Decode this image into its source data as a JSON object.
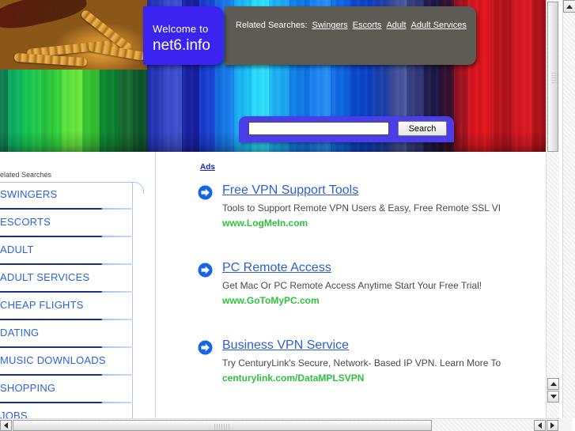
{
  "banner": {
    "welcome": {
      "line1": "Welcome to",
      "line2": "net6.info",
      "bg_color": "#3c24f0"
    },
    "related_bar": {
      "label": "Related Searches:",
      "bg_color": "#5e5b55",
      "links": [
        "Swingers",
        "Escorts",
        "Adult",
        "Adult Services"
      ]
    },
    "search": {
      "value": "",
      "placeholder": "",
      "button_label": "Search",
      "bar_color": "#4b3de8"
    }
  },
  "sidebar": {
    "title": "elated Searches",
    "link_color": "#2a63e0",
    "items": [
      {
        "label": "SWINGERS"
      },
      {
        "label": "ESCORTS"
      },
      {
        "label": "ADULT"
      },
      {
        "label": "ADULT SERVICES"
      },
      {
        "label": "CHEAP FLIGHTS"
      },
      {
        "label": "DATING"
      },
      {
        "label": "MUSIC DOWNLOADS"
      },
      {
        "label": "SHOPPING"
      },
      {
        "label": "JOBS"
      }
    ]
  },
  "ads": {
    "label": "Ads",
    "title_color": "#2a5fd8",
    "url_color": "#2ec33b",
    "items": [
      {
        "title": "Free VPN Support Tools",
        "description": "Tools to Support Remote VPN Users & Easy, Free Remote SSL VI",
        "url": "www.LogMeIn.com",
        "icon": "arrow-right-circle-icon"
      },
      {
        "title": "PC Remote Access",
        "description": "Get Mac Or PC Remote Access Anytime Start Your Free Trial!",
        "url": "www.GoToMyPC.com",
        "icon": "arrow-right-circle-icon"
      },
      {
        "title": "Business VPN Service",
        "description": "Try CenturyLink's Secure, Network- Based IP VPN. Learn More To",
        "url": "centurylink.com/DataMPLSVPN",
        "icon": "arrow-right-circle-icon"
      }
    ]
  },
  "scrollbars": {
    "vertical_outer_up": "scroll-up-icon",
    "vertical_inner_up": "scroll-up-icon",
    "vertical_inner_down": "scroll-down-icon",
    "horizontal_left": "scroll-left-icon",
    "horizontal_left2": "scroll-left-icon",
    "horizontal_right2": "scroll-right-icon"
  }
}
